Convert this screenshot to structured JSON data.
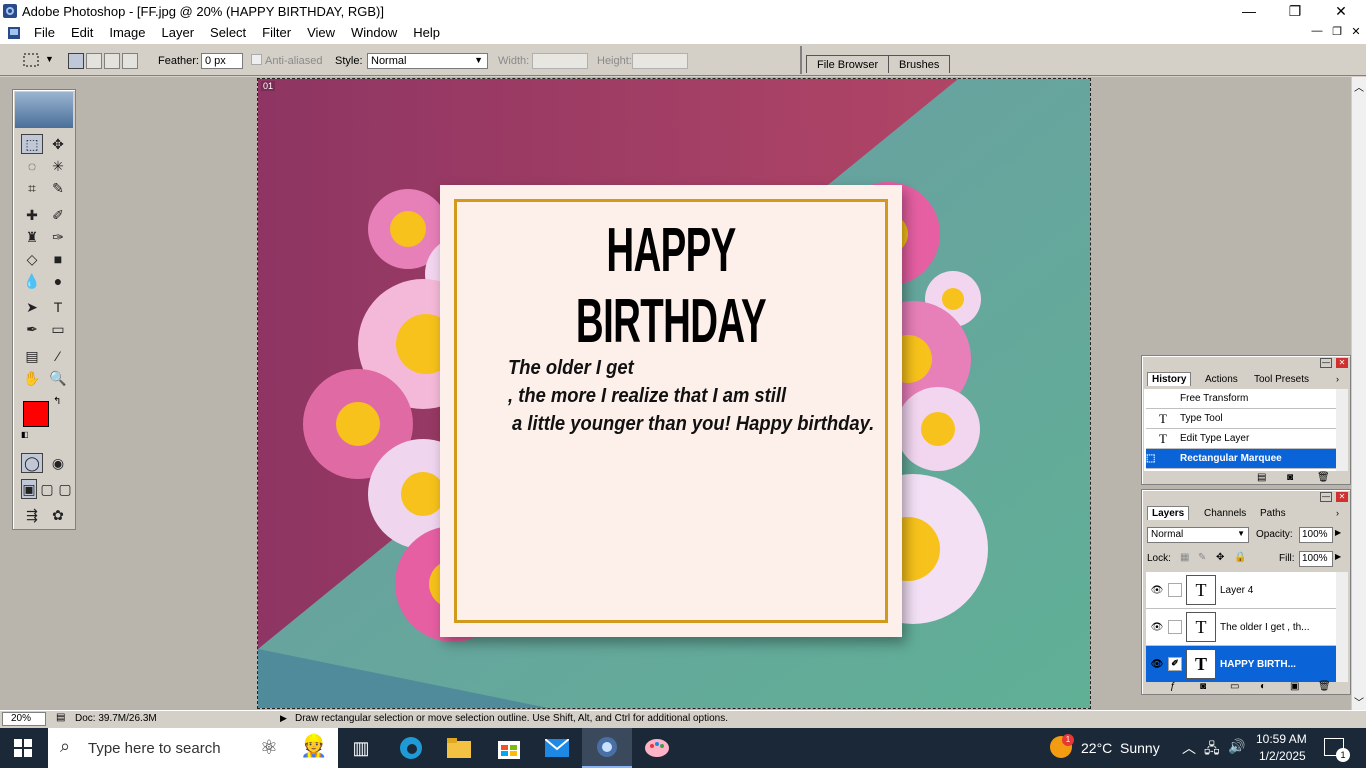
{
  "window": {
    "title": "Adobe Photoshop - [FF.jpg @ 20% (HAPPY BIRTHDAY, RGB)]",
    "minimize": "—",
    "maximize": "❐",
    "close": "✕"
  },
  "menu": [
    "File",
    "Edit",
    "Image",
    "Layer",
    "Select",
    "Filter",
    "View",
    "Window",
    "Help"
  ],
  "options": {
    "feather_label": "Feather:",
    "feather_value": "0 px",
    "antialias_label": "Anti-aliased",
    "style_label": "Style:",
    "style_value": "Normal",
    "width_label": "Width:",
    "height_label": "Height:",
    "file_browser_tab": "File Browser",
    "brushes_tab": "Brushes"
  },
  "canvas": {
    "headline": "HAPPY BIRTHDAY",
    "lines": [
      "The older I get",
      ", the more I realize that I am still",
      "a little younger than you! Happy birthday."
    ],
    "ruler_label": "01",
    "colors": {
      "bg_left": "#a13a66",
      "bg_right": "#5f9aa0",
      "bg_bottom": "#5aa08f",
      "card": "#fdf0ea",
      "border": "#d19a1c"
    }
  },
  "toolbox": {
    "foreground": "#ff0000",
    "background": "#ffffff"
  },
  "history": {
    "tabs": [
      "History",
      "Actions",
      "Tool Presets"
    ],
    "items": [
      {
        "label": "Free Transform",
        "icon": "transform-icon"
      },
      {
        "label": "Type Tool",
        "icon": "type-icon"
      },
      {
        "label": "Edit Type Layer",
        "icon": "type-icon"
      },
      {
        "label": "Rectangular Marquee",
        "icon": "marquee-icon",
        "selected": true
      }
    ]
  },
  "layers": {
    "tabs": [
      "Layers",
      "Channels",
      "Paths"
    ],
    "blend_mode": "Normal",
    "opacity_label": "Opacity:",
    "opacity_value": "100%",
    "lock_label": "Lock:",
    "fill_label": "Fill:",
    "fill_value": "100%",
    "items": [
      {
        "name": "Layer 4"
      },
      {
        "name": "The older I get , th..."
      },
      {
        "name": "HAPPY BIRTH...",
        "selected": true
      }
    ]
  },
  "status": {
    "zoom": "20%",
    "doc": "Doc: 39.7M/26.3M",
    "hint": "Draw rectangular selection or move selection outline.  Use Shift, Alt, and Ctrl for additional options."
  },
  "taskbar": {
    "search_placeholder": "Type here to search",
    "weather_temp": "22°C",
    "weather_desc": "Sunny",
    "weather_badge": "1",
    "time": "10:59 AM",
    "date": "1/2/2025",
    "notification_count": "1"
  }
}
